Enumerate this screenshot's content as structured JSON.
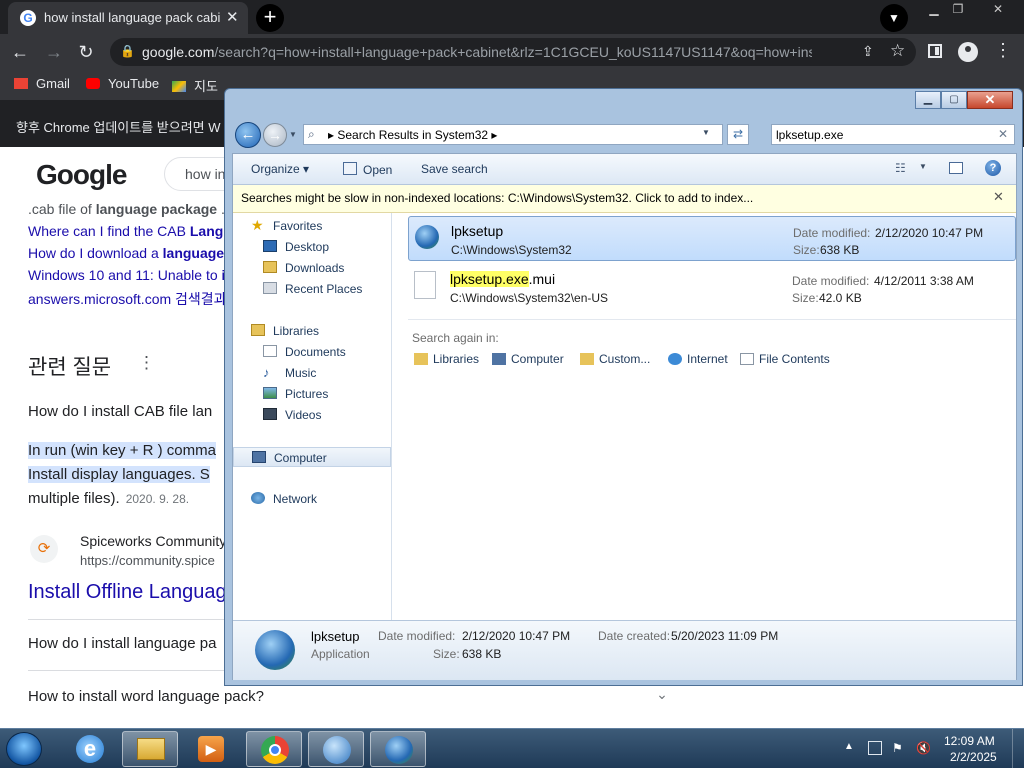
{
  "chrome": {
    "tab_title": "how install language pack cabinet",
    "tab_close": "✕",
    "new_tab": "+",
    "url_host": "google.com",
    "url_rest": "/search?q=how+install+language+pack+cabinet&rlz=1C1GCEU_koUS1147US1147&oq=how+install...",
    "bookmarks": [
      "Gmail",
      "YouTube",
      "지도"
    ],
    "update_text": "향후 Chrome 업데이트를 받으려면 W"
  },
  "google": {
    "logo": "Google",
    "search_text": "how in",
    "results_snippets": [
      {
        "pre": ".cab file of ",
        "bold": "language package",
        "post": " ."
      },
      {
        "pre": "Where can I find the CAB ",
        "bold": "Lang",
        "post": ""
      },
      {
        "pre": "How do I download a ",
        "bold": "language",
        "post": ""
      },
      {
        "pre": "Windows 10 and 11: Unable to ",
        "bold": "i",
        "post": ""
      },
      {
        "pre": "answers.microsoft.com 검색결과",
        "bold": "",
        "post": ""
      }
    ],
    "related_heading": "관련 질문",
    "related_more": "⋮",
    "faq_question": "How do I install CAB file lan",
    "faq_answer_1": "In run (win key + R ) comma",
    "faq_answer_2": "Install display languages. S",
    "faq_answer_3": "multiple files).",
    "faq_date": "2020. 9. 28.",
    "source_name": "Spiceworks Community",
    "source_url": "https://community.spice",
    "result_title": "Install Offline Languag",
    "paa_1": "How do I install language pa",
    "paa_2": "How to install word language pack?"
  },
  "explorer": {
    "address_path": "Search Results in System32",
    "search_query": "lpksetup.exe",
    "toolbar": {
      "organize": "Organize",
      "open": "Open",
      "save_search": "Save search"
    },
    "infobar": "Searches might be slow in non-indexed locations: C:\\Windows\\System32. Click to add to index...",
    "nav": {
      "favorites": "Favorites",
      "desktop": "Desktop",
      "downloads": "Downloads",
      "recent": "Recent Places",
      "libraries": "Libraries",
      "documents": "Documents",
      "music": "Music",
      "pictures": "Pictures",
      "videos": "Videos",
      "computer": "Computer",
      "network": "Network"
    },
    "results": [
      {
        "name": "lpksetup",
        "path": "C:\\Windows\\System32",
        "modified_label": "Date modified:",
        "modified": "2/12/2020 10:47 PM",
        "size_label": "Size:",
        "size": "638 KB"
      },
      {
        "name_highlight": "lpksetup.exe",
        "name_rest": ".mui",
        "path": "C:\\Windows\\System32\\en-US",
        "modified_label": "Date modified:",
        "modified": "4/12/2011 3:38 AM",
        "size_label": "Size:",
        "size": "42.0 KB"
      }
    ],
    "search_again_label": "Search again in:",
    "search_again": [
      "Libraries",
      "Computer",
      "Custom...",
      "Internet",
      "File Contents"
    ],
    "details": {
      "name": "lpksetup",
      "type": "Application",
      "modified_label": "Date modified:",
      "modified": "2/12/2020 10:47 PM",
      "size_label": "Size:",
      "size": "638 KB",
      "created_label": "Date created:",
      "created": "5/20/2023 11:09 PM"
    }
  },
  "taskbar": {
    "time": "12:09 AM",
    "date": "2/2/2025"
  },
  "colors": {
    "chrome_dark": "#202124",
    "chrome_toolbar": "#35363a",
    "explorer_frame": "#a9c3df",
    "selection": "#c1dcfc",
    "link_blue": "#1a0dab",
    "taskbar": "#1f3a57"
  }
}
